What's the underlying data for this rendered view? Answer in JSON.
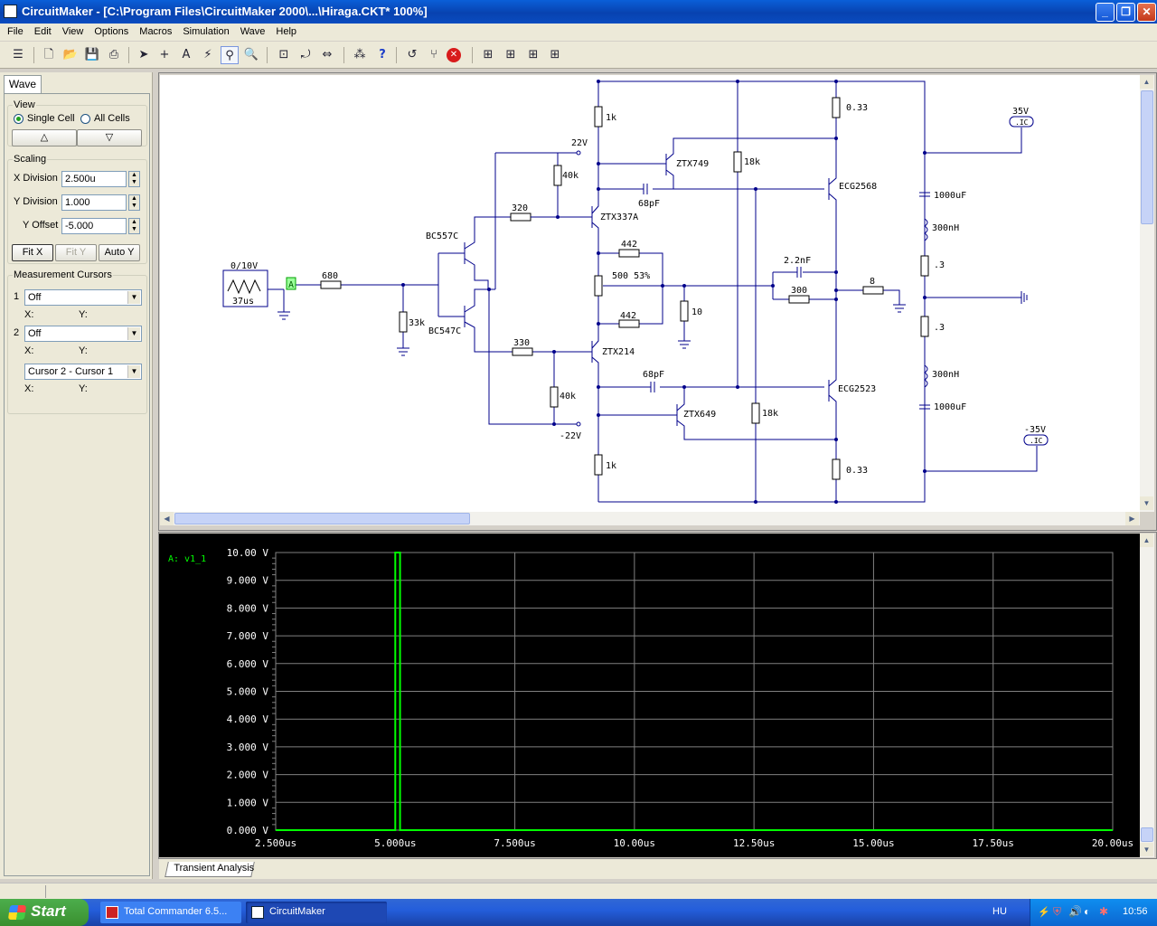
{
  "window": {
    "title": "CircuitMaker - [C:\\Program Files\\CircuitMaker 2000\\...\\Hiraga.CKT* 100%]",
    "min": "_",
    "max": "❐",
    "close": "✕"
  },
  "menu": [
    "File",
    "Edit",
    "View",
    "Options",
    "Macros",
    "Simulation",
    "Wave",
    "Help"
  ],
  "panel": {
    "tab": "Wave",
    "view": {
      "legend": "View",
      "single": "Single Cell",
      "all": "All Cells",
      "up": "△",
      "down": "▽"
    },
    "scaling": {
      "legend": "Scaling",
      "xdiv_label": "X Division",
      "xdiv": "2.500u",
      "ydiv_label": "Y Division",
      "ydiv": "1.000",
      "yoff_label": "Y Offset",
      "yoff": "-5.000",
      "fitx": "Fit X",
      "fity": "Fit Y",
      "autoy": "Auto Y"
    },
    "cursors": {
      "legend": "Measurement Cursors",
      "c1_num": "1",
      "c1": "Off",
      "c2_num": "2",
      "c2": "Off",
      "diff": "Cursor 2 - Cursor 1",
      "x": "X:",
      "y": "Y:"
    }
  },
  "schematic": {
    "labels": {
      "src": "0/10V",
      "src_t": "37us",
      "probe": "A",
      "r680": "680",
      "r33k": "33k",
      "bc557": "BC557C",
      "bc547": "BC547C",
      "r320": "320",
      "r330": "330",
      "r40k_top": "40k",
      "r40k_bot": "40k",
      "v22": "22V",
      "vm22": "-22V",
      "r1k_top": "1k",
      "r1k_bot": "1k",
      "ztx337": "ZTX337A",
      "ztx214": "ZTX214",
      "ztx749": "ZTX749",
      "ztx649": "ZTX649",
      "c68_top": "68pF",
      "c68_bot": "68pF",
      "r442_top": "442",
      "r442_bot": "442",
      "pot": "500 53%",
      "r10": "10",
      "r18k_a": "18k",
      "r18k_b": "18k",
      "c22n": "2.2nF",
      "r300": "300",
      "r8": "8",
      "ecg2568": "ECG2568",
      "ecg2523": "ECG2523",
      "r033_top": "0.33",
      "r033_bot": "0.33",
      "c1000_top": "1000uF",
      "c1000_bot": "1000uF",
      "l300_top": "300nH",
      "l300_bot": "300nH",
      "r03_top": ".3",
      "r03_bot": ".3",
      "v35": "35V",
      "vm35": "-35V",
      "ic": ".IC"
    }
  },
  "wave": {
    "tab": "Transient Analysis"
  },
  "chart_data": {
    "type": "line",
    "title": "",
    "series": [
      {
        "name": "A: v1_1",
        "x": [
          "2.500us",
          "4.000us",
          "4.000us",
          "4.100us",
          "4.100us",
          "5.000us",
          "5.000us",
          "5.100us",
          "5.100us",
          "20.00us"
        ],
        "y": [
          0,
          0,
          0,
          0,
          0,
          0,
          10,
          10,
          0,
          0
        ]
      }
    ],
    "xticks": [
      "2.500us",
      "5.000us",
      "7.500us",
      "10.00us",
      "12.50us",
      "15.00us",
      "17.50us",
      "20.00us"
    ],
    "yticks": [
      "0.000 V",
      "1.000 V",
      "2.000 V",
      "3.000 V",
      "4.000 V",
      "5.000 V",
      "6.000 V",
      "7.000 V",
      "8.000 V",
      "9.000 V",
      "10.00 V"
    ],
    "xlim_us": [
      2.5,
      20
    ],
    "ylim": [
      0,
      10
    ],
    "grid": true,
    "colors": {
      "trace": "#00ff00",
      "label": "#00ff00",
      "grid": "#808080",
      "bg": "#000000",
      "axis_text": "#ffffff"
    }
  },
  "taskbar": {
    "start": "Start",
    "tasks": [
      "Total Commander 6.5...",
      "CircuitMaker"
    ],
    "lang": "HU",
    "clock": "10:56"
  }
}
